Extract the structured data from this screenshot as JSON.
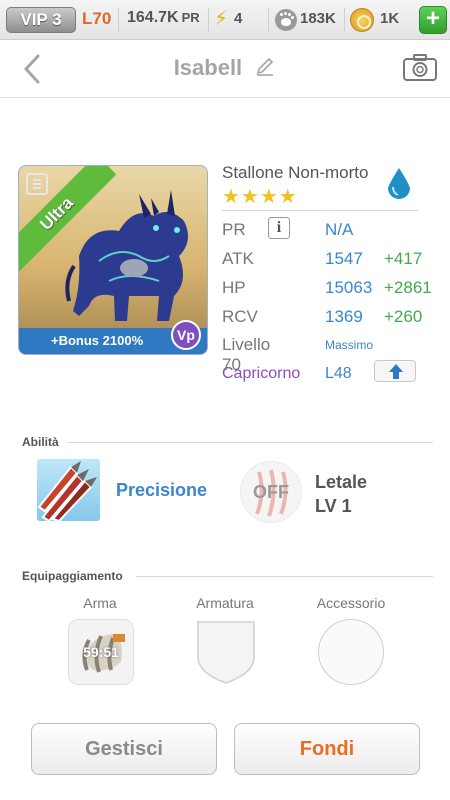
{
  "topbar": {
    "vip": "VIP 3",
    "level": "L70",
    "power_value": "164.7K",
    "power_unit": "PR",
    "energy": "4",
    "food": "183K",
    "gold": "1K",
    "add_label": "+"
  },
  "header": {
    "title": "Isabell"
  },
  "monster": {
    "rarity": "Ultra",
    "bonus": "+Bonus 2100%",
    "badge": "Vp",
    "name": "Stallone Non-morto",
    "stars": "★★★★",
    "stats": [
      {
        "label": "PR",
        "value": "N/A",
        "bonus": ""
      },
      {
        "label": "ATK",
        "value": "1547",
        "bonus": "+417"
      },
      {
        "label": "HP",
        "value": "15063",
        "bonus": "+2861"
      },
      {
        "label": "RCV",
        "value": "1369",
        "bonus": "+260"
      }
    ],
    "level_label": "Livello 70",
    "level_max": "Massimo",
    "zodiac": "Capricorno",
    "zodiac_level": "L48"
  },
  "abilities": {
    "heading": "Abilità",
    "skill1": "Precisione",
    "skill2_status": "OFF",
    "skill2_name": "Letale",
    "skill2_level": "LV 1"
  },
  "equipment": {
    "heading": "Equipaggiamento",
    "slots": [
      "Arma",
      "Armatura",
      "Accessorio"
    ],
    "weapon_timer": "59:51"
  },
  "buttons": {
    "manage": "Gestisci",
    "fuse": "Fondi"
  },
  "colors": {
    "accent_blue": "#3a86cf",
    "bonus_green": "#43a84a",
    "zodiac_purple": "#8a4bbf",
    "fuse_orange": "#ef6b22"
  },
  "icons": [
    "back-arrow-icon",
    "edit-pencil-icon",
    "camera-icon",
    "bolt-icon",
    "paw-icon",
    "coin-icon",
    "water-drop-icon",
    "info-icon",
    "arrow-up-icon",
    "claw-icon"
  ]
}
